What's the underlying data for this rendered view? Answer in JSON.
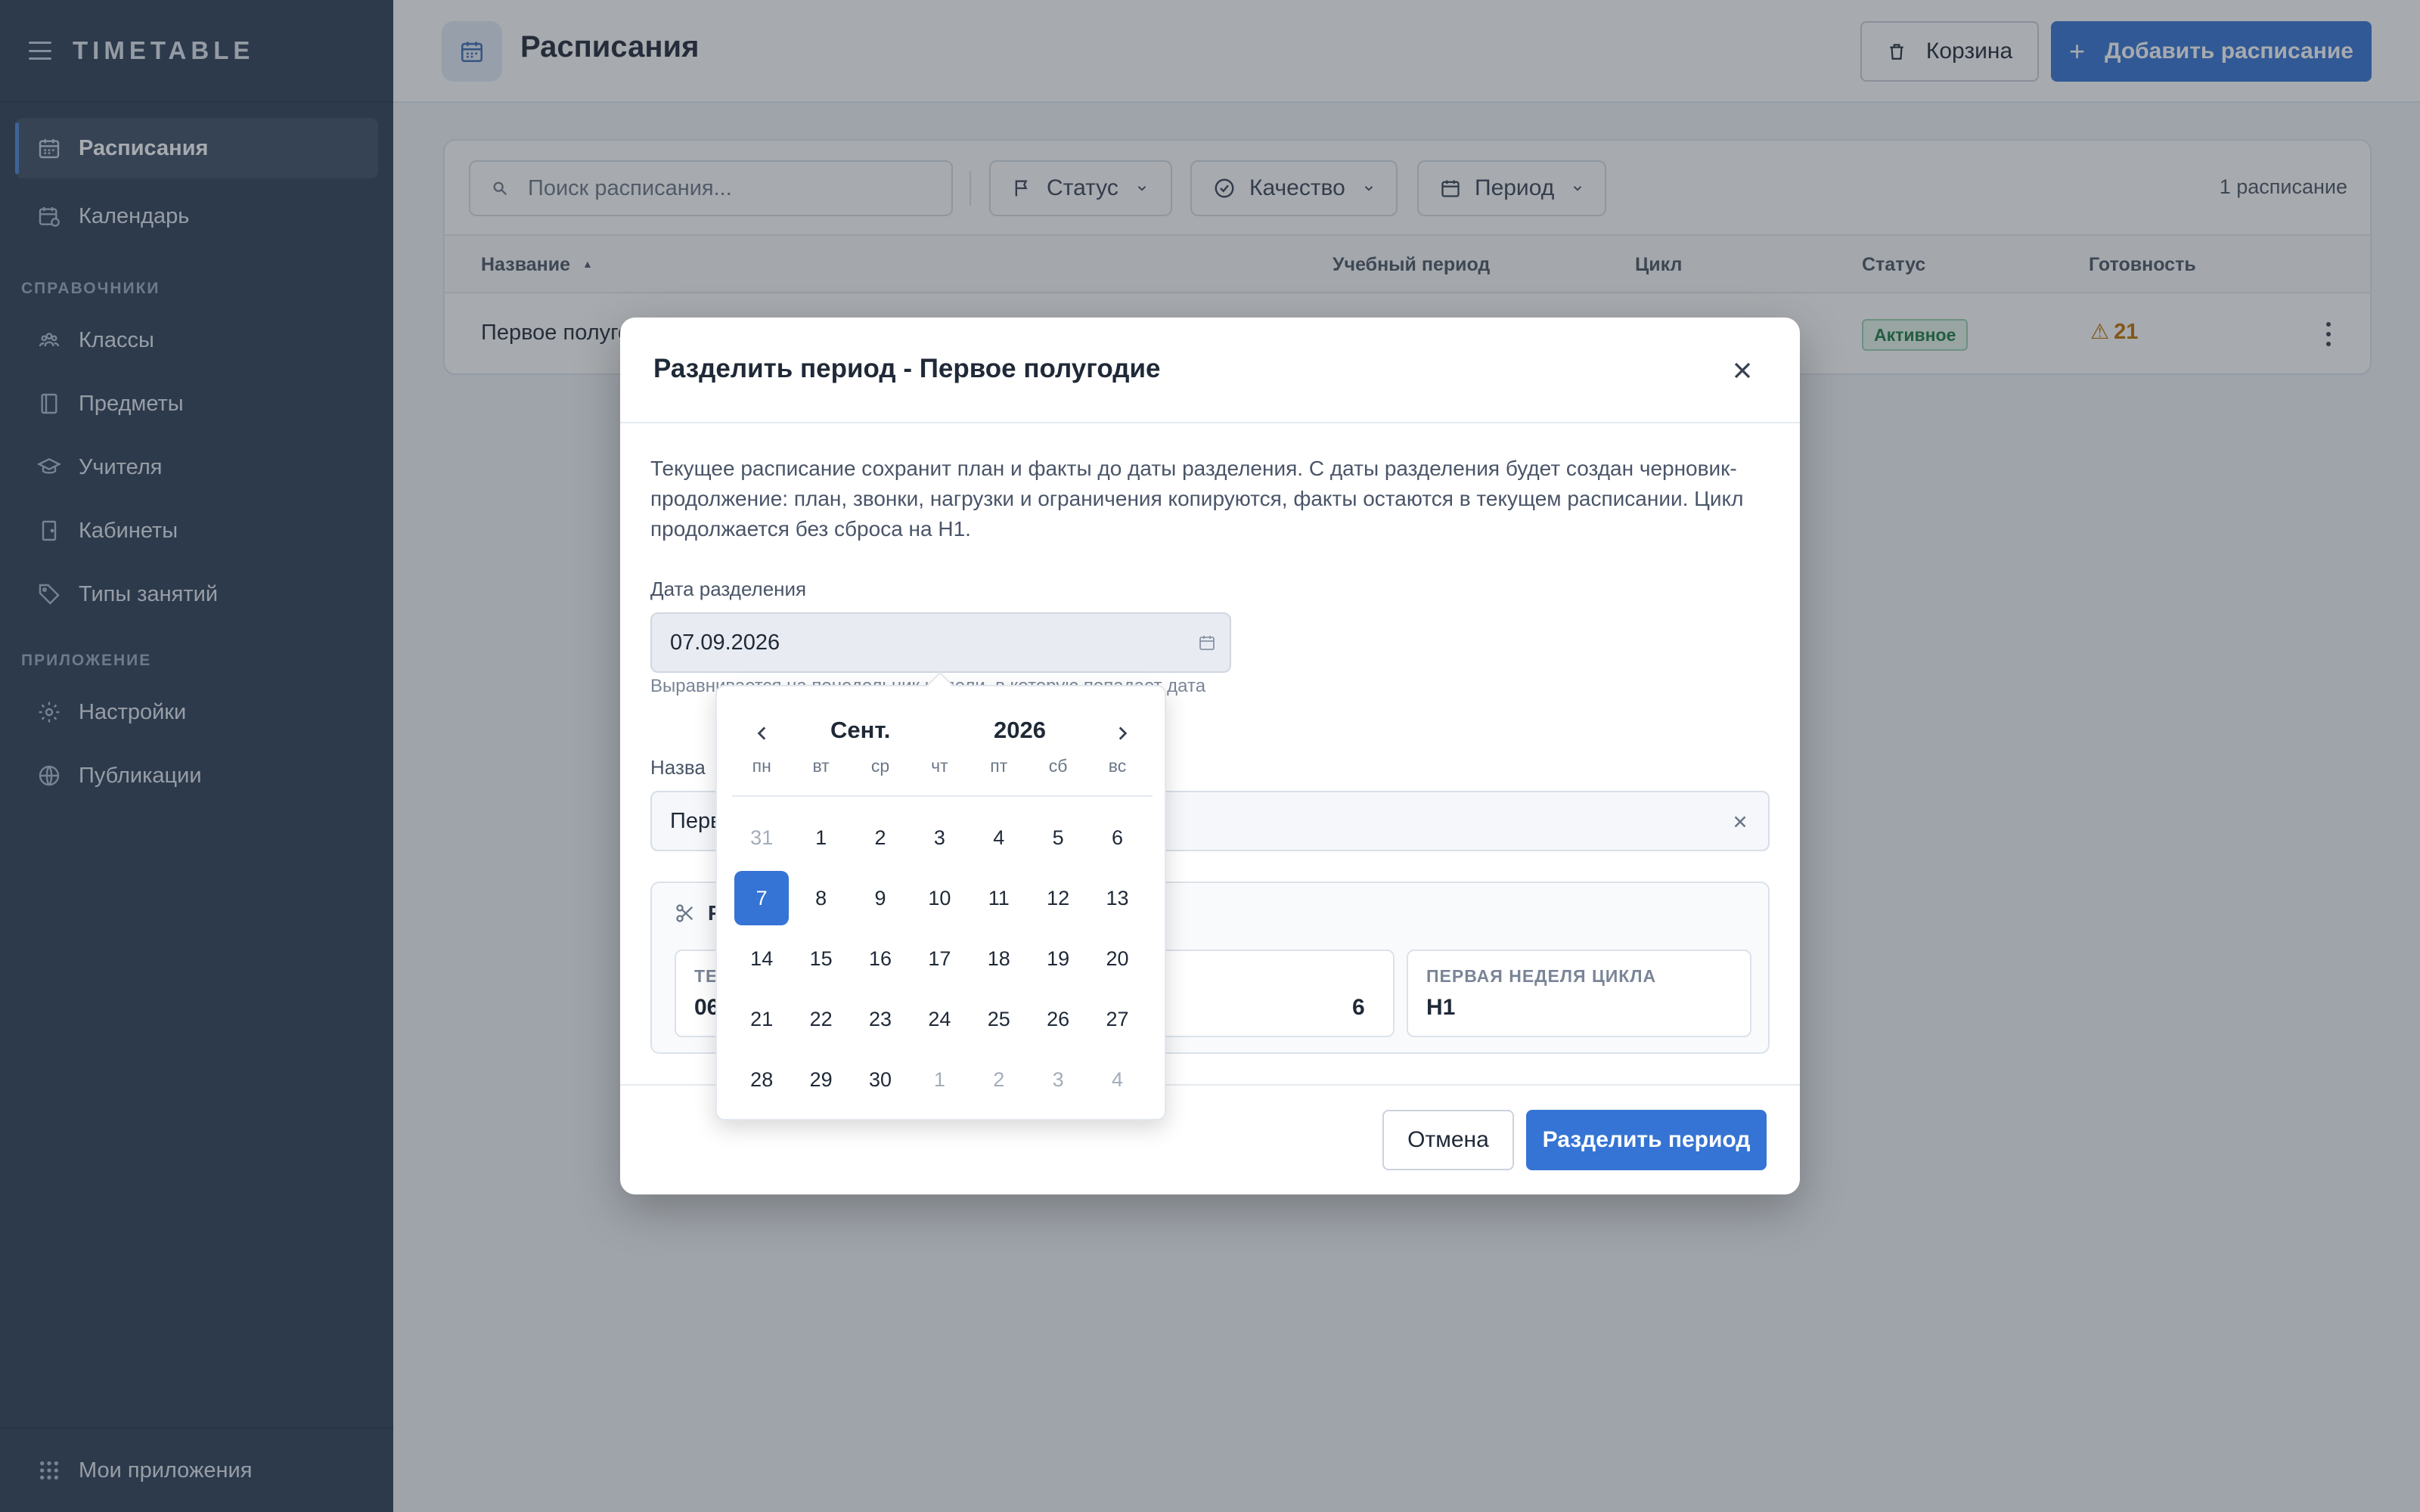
{
  "app": {
    "brand": "TIMETABLE"
  },
  "sidebar": {
    "items": [
      {
        "label": "Расписания",
        "icon": "calendar-icon",
        "active": true
      },
      {
        "label": "Календарь",
        "icon": "calendar-clock-icon"
      }
    ],
    "section_references": "СПРАВОЧНИКИ",
    "references": [
      {
        "label": "Классы",
        "icon": "group-icon"
      },
      {
        "label": "Предметы",
        "icon": "book-icon"
      },
      {
        "label": "Учителя",
        "icon": "graduation-cap-icon"
      },
      {
        "label": "Кабинеты",
        "icon": "door-icon"
      },
      {
        "label": "Типы занятий",
        "icon": "tag-icon"
      }
    ],
    "section_app": "ПРИЛОЖЕНИЕ",
    "app_items": [
      {
        "label": "Настройки",
        "icon": "gear-icon"
      },
      {
        "label": "Публикации",
        "icon": "globe-icon"
      }
    ],
    "footer": "Мои приложения"
  },
  "header": {
    "title": "Расписания",
    "trash_label": "Корзина",
    "add_label": "Добавить расписание"
  },
  "toolbar": {
    "search_placeholder": "Поиск расписания...",
    "filters": [
      "Статус",
      "Качество",
      "Период"
    ],
    "count": "1 расписание"
  },
  "table": {
    "columns": [
      "Название",
      "Учебный период",
      "Цикл",
      "Статус",
      "Готовность"
    ],
    "rows": [
      {
        "name": "Первое полугодие",
        "status": "Активное",
        "readiness": "21"
      }
    ]
  },
  "modal": {
    "title": "Разделить период - Первое полугодие",
    "description": "Текущее расписание сохранит план и факты до даты разделения. С даты разделения будет создан черновик-продолжение: план, звонки, нагрузки и ограничения копируются, факты остаются в текущем расписании. Цикл продолжается без сброса на Н1.",
    "date_label": "Дата разделения",
    "date_value": "07.09.2026",
    "hint": "Выравнивается на понедельник недели, в которую попадает дата",
    "name_label": "Назва",
    "name_value": "Перв",
    "stats": [
      {
        "label": "ТЕ",
        "value": "06"
      },
      {
        "label": "",
        "value": "6"
      },
      {
        "label": "ПЕРВАЯ НЕДЕЛЯ ЦИКЛА",
        "value": "Н1"
      }
    ],
    "split_title": "Р",
    "cancel_label": "Отмена",
    "submit_label": "Разделить период"
  },
  "datepicker": {
    "month": "Сент.",
    "year": "2026",
    "weekdays": [
      "пн",
      "вт",
      "ср",
      "чт",
      "пт",
      "сб",
      "вс"
    ],
    "days": [
      "31",
      "1",
      "2",
      "3",
      "4",
      "5",
      "6",
      "7",
      "8",
      "9",
      "10",
      "11",
      "12",
      "13",
      "14",
      "15",
      "16",
      "17",
      "18",
      "19",
      "20",
      "21",
      "22",
      "23",
      "24",
      "25",
      "26",
      "27",
      "28",
      "29",
      "30",
      "1",
      "2",
      "3",
      "4"
    ],
    "selected": "7"
  },
  "colors": {
    "accent": "#3574d4",
    "sidebar": "#2c3e56",
    "warning": "#c07000",
    "success": "#1d7a44"
  }
}
